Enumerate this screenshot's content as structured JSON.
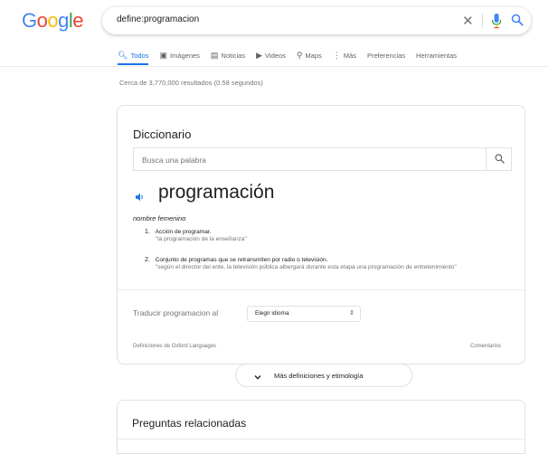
{
  "logo": {
    "text": "Google"
  },
  "search": {
    "query": "define:programacion"
  },
  "tabs": [
    {
      "label": "Todos",
      "icon": "search-icon",
      "active": true
    },
    {
      "label": "Imágenes",
      "icon": "image-icon",
      "active": false
    },
    {
      "label": "Noticias",
      "icon": "news-icon",
      "active": false
    },
    {
      "label": "Videos",
      "icon": "video-icon",
      "active": false
    },
    {
      "label": "Maps",
      "icon": "map-pin-icon",
      "active": false
    },
    {
      "label": "Más",
      "icon": "more-vert-icon",
      "active": false
    },
    {
      "label": "Preferencias",
      "icon": "",
      "active": false
    },
    {
      "label": "Herramientas",
      "icon": "",
      "active": false
    }
  ],
  "result_stats": "Cerca de 3,770,000 resultados (0.58 segundos)",
  "dictionary": {
    "title": "Diccionario",
    "input_placeholder": "Busca una palabra",
    "word": "programación",
    "part_of_speech": "nombre femenino",
    "definitions": [
      {
        "num": "1.",
        "text": "Acción de programar.",
        "example": "\"la programación de la enseñanza\""
      },
      {
        "num": "2.",
        "text": "Conjunto de programas que se retransmiten por radio o televisión.",
        "example": "\"según el director del ente, la televisión pública albergará durante esta etapa una programación de entretenimiento\""
      }
    ],
    "translate_label": "Traducir programacion al",
    "language_select": "Elegir idioma",
    "source": "Definiciones de Oxford Languages",
    "feedback": "Comentarios"
  },
  "more_button": {
    "label": "Más definiciones y etimología"
  },
  "related": {
    "title": "Preguntas relacionadas"
  },
  "colors": {
    "accent": "#1a73e8",
    "mic_blue": "#4285f4",
    "mic_red": "#ea4335",
    "border": "#dfe1e5",
    "muted": "#70757a"
  }
}
